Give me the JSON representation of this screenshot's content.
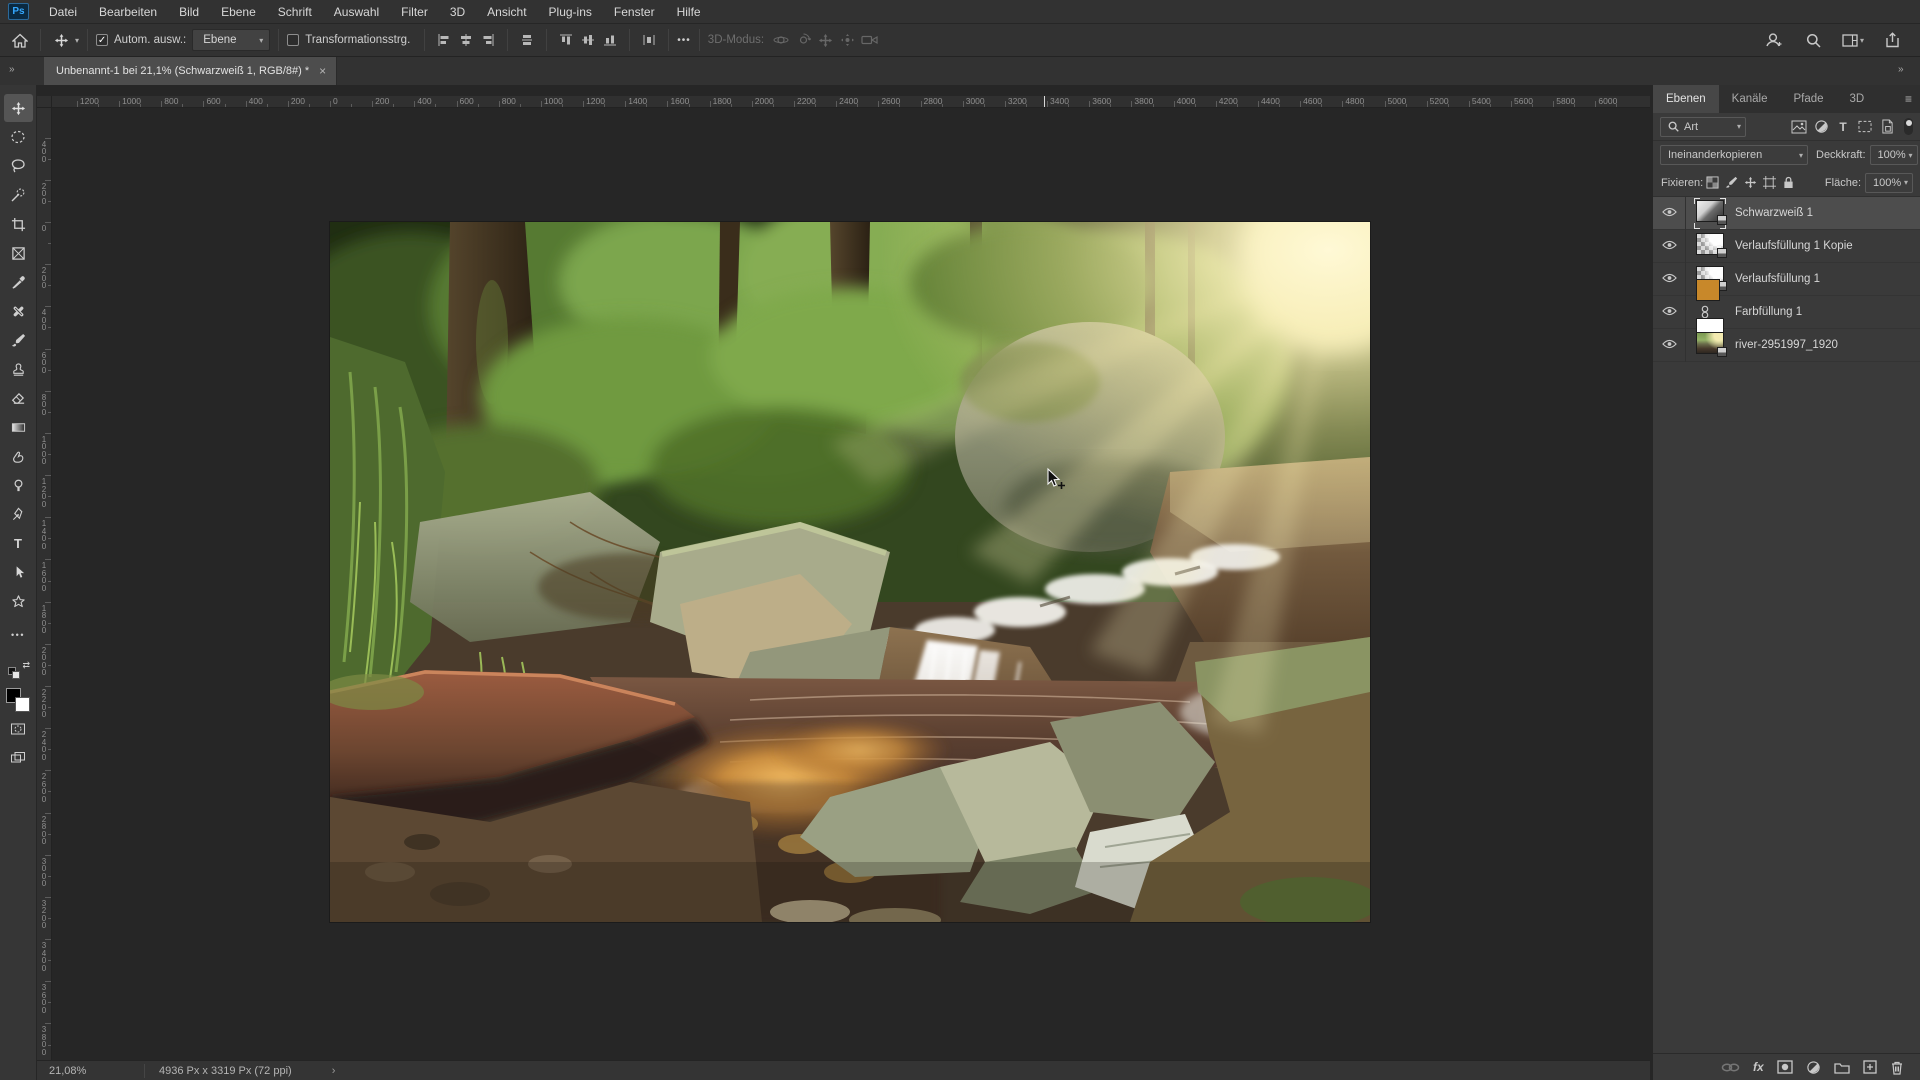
{
  "menu_bar": {
    "logo": "Ps",
    "items": [
      "Datei",
      "Bearbeiten",
      "Bild",
      "Ebene",
      "Schrift",
      "Auswahl",
      "Filter",
      "3D",
      "Ansicht",
      "Plug-ins",
      "Fenster",
      "Hilfe"
    ]
  },
  "options_bar": {
    "auto_select": {
      "label": "Autom. ausw.:",
      "checked": true,
      "check_glyph": "✓",
      "value": "Ebene"
    },
    "transform_controls": {
      "label": "Transformationsstrg.",
      "checked": false
    },
    "more_label": "•••",
    "mode_3d_label": "3D-Modus:"
  },
  "document_tab": {
    "title": "Unbenannt-1 bei 21,1% (Schwarzweiß 1, RGB/8#) *",
    "close_label": "×"
  },
  "toolbar": {
    "selected_tool": "move-tool",
    "tools": [
      "move-tool",
      "marquee-tool",
      "lasso-tool",
      "quick-selection-tool",
      "crop-tool",
      "frame-tool",
      "eyedropper-tool",
      "healing-brush-tool",
      "brush-tool",
      "clone-stamp-tool",
      "eraser-tool",
      "gradient-tool",
      "smudge-tool",
      "dodge-tool",
      "pen-tool",
      "type-tool",
      "path-selection-tool",
      "custom-shape-tool",
      "more-tools",
      "swap-colors",
      "foreground-background-color",
      "quick-mask-mode",
      "screen-mode"
    ]
  },
  "rulers": {
    "unit_step": 200,
    "pixels_per_unit": 0.2109,
    "h_first": -1200,
    "h_last": 6000,
    "v_first": -400,
    "v_last": 3800
  },
  "canvas": {
    "image_alt": "Wasserfall über moosige Felsen in einem sonnendurchfluteten Wald"
  },
  "layers_panel": {
    "tabs": [
      "Ebenen",
      "Kanäle",
      "Pfade",
      "3D"
    ],
    "active_tab_index": 0,
    "search_value": "Art",
    "blend_mode": "Ineinanderkopieren",
    "opacity_label": "Deckkraft:",
    "opacity_value": "100%",
    "lock_label": "Fixieren:",
    "fill_label": "Fläche:",
    "fill_value": "100%",
    "fx_label": "fx",
    "layers": [
      {
        "name": "Schwarzweiß 1",
        "type": "adjustment",
        "visible": true,
        "selected": true
      },
      {
        "name": "Verlaufsfüllung 1 Kopie",
        "type": "gradient",
        "visible": true,
        "selected": false
      },
      {
        "name": "Verlaufsfüllung 1",
        "type": "gradient",
        "visible": true,
        "selected": false
      },
      {
        "name": "Farbfüllung 1",
        "type": "color",
        "color": "#c8882a",
        "has_mask": true,
        "visible": true,
        "selected": false
      },
      {
        "name": "river-2951997_1920",
        "type": "photo",
        "visible": true,
        "selected": false
      }
    ]
  },
  "status_bar": {
    "zoom": "21,08%",
    "document_size": "4936 Px x 3319 Px (72 ppi)",
    "chevron": "›"
  }
}
